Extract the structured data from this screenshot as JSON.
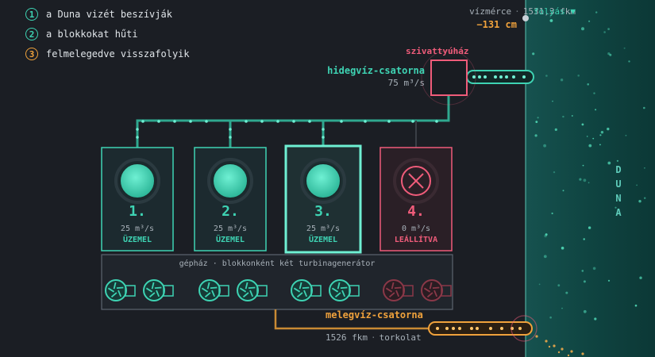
{
  "legend": [
    {
      "num": "1",
      "text": "a Duna vizét beszívják"
    },
    {
      "num": "2",
      "text": "a blokkokat hűti"
    },
    {
      "num": "3",
      "text": "felmelegedve visszafolyik"
    }
  ],
  "gauge": {
    "label": "vízmérce",
    "km": "1531,3 fkm",
    "value": "−131 cm"
  },
  "flow_label": "folyás ▼",
  "pump_house": "szivattyúház",
  "cold_channel": {
    "name": "hidegvíz-csatorna",
    "rate": "75 m³/s"
  },
  "blocks": [
    {
      "num": "1.",
      "rate": "25 m³/s",
      "status": "ÜZEMEL",
      "active": true
    },
    {
      "num": "2.",
      "rate": "25 m³/s",
      "status": "ÜZEMEL",
      "active": true
    },
    {
      "num": "3.",
      "rate": "25 m³/s",
      "status": "ÜZEMEL",
      "active": true,
      "highlighted": true
    },
    {
      "num": "4.",
      "rate": "0 m³/s",
      "status": "LEÁLLÍTVA",
      "active": false
    }
  ],
  "turbine_hall": "gépház · blokkonként két turbinagenerátor",
  "warm_channel": {
    "name": "melegvíz-csatorna"
  },
  "river_footer": {
    "km": "1526 fkm",
    "label": "torkolat"
  },
  "river_name": "DUNA",
  "colors": {
    "cold": "#3ed3b3",
    "warm": "#f0a23c",
    "alert": "#ef5c7a",
    "bg": "#1b1e24",
    "river": "#0f3c3b"
  }
}
